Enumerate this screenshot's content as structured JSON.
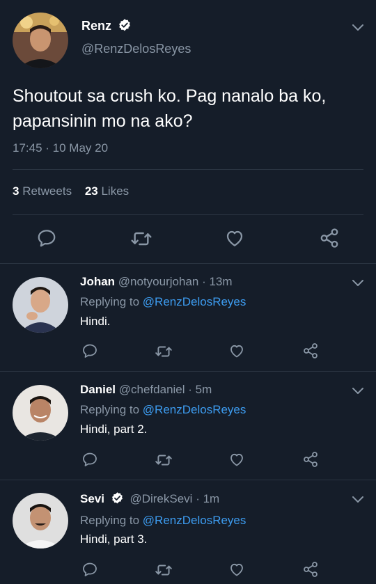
{
  "main_tweet": {
    "name": "Renz",
    "handle": "@RenzDelosReyes",
    "text": "Shoutout sa crush ko. Pag nanalo ba ko, papansinin mo na ako?",
    "timestamp": "17:45 · 10 May 20",
    "retweet_count": "3",
    "retweet_label": "Retweets",
    "like_count": "23",
    "like_label": "Likes",
    "verified": true
  },
  "replies": [
    {
      "name": "Johan",
      "handle": "@notyourjohan",
      "time": "· 13m",
      "replying_prefix": "Replying to",
      "replying_to": "@RenzDelosReyes",
      "text": "Hindi.",
      "verified": false
    },
    {
      "name": "Daniel",
      "handle": "@chefdaniel",
      "time": "· 5m",
      "replying_prefix": "Replying to",
      "replying_to": "@RenzDelosReyes",
      "text": "Hindi, part 2.",
      "verified": false
    },
    {
      "name": "Sevi",
      "handle": "@DirekSevi",
      "time": "· 1m",
      "replying_prefix": "Replying to",
      "replying_to": "@RenzDelosReyes",
      "text": "Hindi, part 3.",
      "verified": true
    }
  ],
  "icons": {
    "reply": "reply-icon",
    "retweet": "retweet-icon",
    "like": "heart-icon",
    "share": "share-icon",
    "more": "chevron-down-icon",
    "verified": "verified-badge-icon"
  },
  "colors": {
    "background": "#151d29",
    "text": "#ffffff",
    "muted": "#8a97a6",
    "link": "#3d9cf0",
    "divider": "#2a3441"
  }
}
